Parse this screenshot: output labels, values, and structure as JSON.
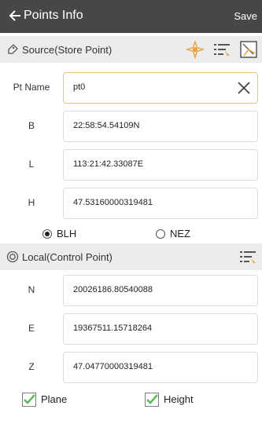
{
  "header": {
    "title": "Points Info",
    "save_label": "Save",
    "icon": "back-arrow-icon"
  },
  "source": {
    "title": "Source(Store Point)",
    "icons": [
      "tag-icon",
      "locate-target-icon",
      "point-list-icon",
      "map-select-icon"
    ],
    "fields": [
      {
        "label": "Pt Name",
        "value": "pt0"
      },
      {
        "label": "B",
        "value": "22:58:54.54109N"
      },
      {
        "label": "L",
        "value": "113:21:42.33087E"
      },
      {
        "label": "H",
        "value": "47.53160000319481"
      }
    ],
    "coord_options": [
      {
        "label": "BLH",
        "selected": true
      },
      {
        "label": "NEZ",
        "selected": false
      }
    ]
  },
  "local": {
    "title": "Local(Control Point)",
    "icons": [
      "target-circle-icon",
      "point-list-icon"
    ],
    "fields": [
      {
        "label": "N",
        "value": "20026186.80540088"
      },
      {
        "label": "E",
        "value": "19367511.15718264"
      },
      {
        "label": "Z",
        "value": "47.04770000319481"
      }
    ],
    "checks": [
      {
        "label": "Plane",
        "checked": true
      },
      {
        "label": "Height",
        "checked": true
      }
    ]
  },
  "colors": {
    "header_bg": "#474747",
    "section_bg": "#ececec",
    "focus_border": "#f5c07a",
    "check_green": "#5cb85c",
    "icon_orange": "#e8a040"
  }
}
